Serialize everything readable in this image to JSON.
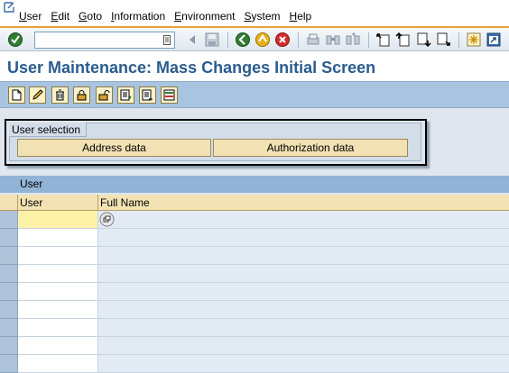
{
  "menu": {
    "items": [
      {
        "label": "User",
        "underline": "U",
        "rest": "ser"
      },
      {
        "label": "Edit",
        "underline": "E",
        "rest": "dit"
      },
      {
        "label": "Goto",
        "underline": "G",
        "rest": "oto"
      },
      {
        "label": "Information",
        "underline": "I",
        "rest": "nformation"
      },
      {
        "label": "Environment",
        "underline": "E",
        "rest": "nvironment"
      },
      {
        "label": "System",
        "underline": "S",
        "rest": "ystem"
      },
      {
        "label": "Help",
        "underline": "H",
        "rest": "elp"
      }
    ]
  },
  "toolbar": {
    "command_field_value": "",
    "icons": [
      "enter-icon",
      "save-icon",
      "back-icon",
      "exit-icon",
      "cancel-icon",
      "print-icon",
      "find-icon",
      "find-next-icon",
      "first-page-icon",
      "previous-page-icon",
      "next-page-icon",
      "last-page-icon",
      "new-session-icon",
      "shortcut-icon"
    ],
    "colors": {
      "accent": "#e8a13a"
    }
  },
  "title": "User Maintenance: Mass Changes Initial Screen",
  "app_toolbar": {
    "icons": [
      "create-icon",
      "change-icon",
      "delete-icon",
      "lock-icon",
      "unlock-icon",
      "list-import-icon",
      "list-export-icon",
      "select-icon"
    ]
  },
  "selection": {
    "group_label": "User selection",
    "address_button": "Address data",
    "authorization_button": "Authorization data"
  },
  "table": {
    "title": "User",
    "columns": [
      "User",
      "Full Name"
    ],
    "rows": [
      {
        "user": "",
        "full_name": ""
      },
      {
        "user": "",
        "full_name": ""
      },
      {
        "user": "",
        "full_name": ""
      },
      {
        "user": "",
        "full_name": ""
      },
      {
        "user": "",
        "full_name": ""
      },
      {
        "user": "",
        "full_name": ""
      },
      {
        "user": "",
        "full_name": ""
      },
      {
        "user": "",
        "full_name": ""
      },
      {
        "user": "",
        "full_name": ""
      }
    ]
  }
}
